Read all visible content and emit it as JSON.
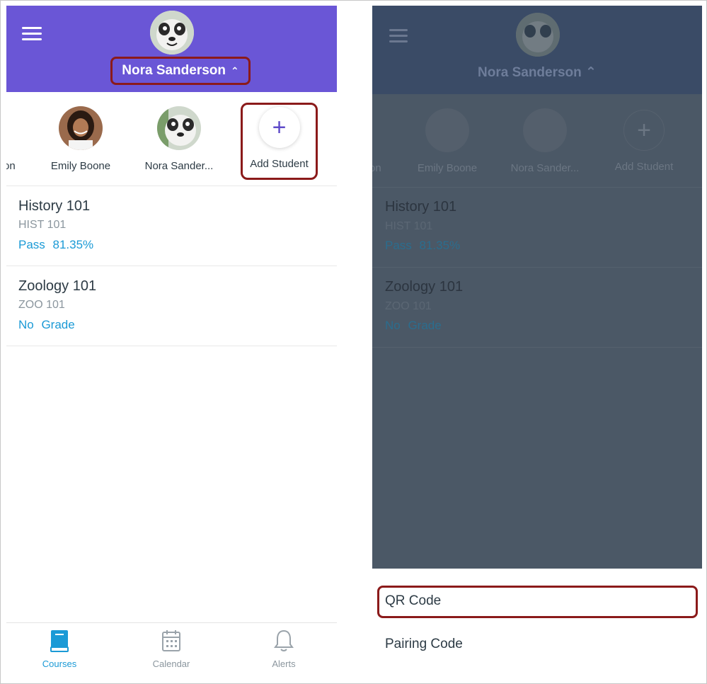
{
  "left": {
    "header": {
      "student_name": "Nora Sanderson",
      "chevron": "⌃"
    },
    "students": [
      {
        "label": "on"
      },
      {
        "label": "Emily Boone"
      },
      {
        "label": "Nora Sander..."
      },
      {
        "label": "Add Student"
      }
    ],
    "add_symbol": "+",
    "courses": [
      {
        "title": "History 101",
        "code": "HIST 101",
        "grade": "Pass 81.35%"
      },
      {
        "title": "Zoology 101",
        "code": "ZOO 101",
        "grade": "No Grade"
      }
    ],
    "tabs": [
      {
        "label": "Courses",
        "icon": "book-icon",
        "active": true
      },
      {
        "label": "Calendar",
        "icon": "calendar-icon",
        "active": false
      },
      {
        "label": "Alerts",
        "icon": "bell-icon",
        "active": false
      }
    ]
  },
  "right": {
    "header": {
      "student_name": "Nora Sanderson ⌃"
    },
    "students": [
      {
        "label": "on"
      },
      {
        "label": "Emily Boone"
      },
      {
        "label": "Nora Sander..."
      },
      {
        "label": "Add Student"
      }
    ],
    "add_symbol": "+",
    "courses": [
      {
        "title": "History 101",
        "code": "HIST 101",
        "grade": "Pass 81.35%"
      },
      {
        "title": "Zoology 101",
        "code": "ZOO 101",
        "grade": "No Grade"
      }
    ],
    "sheet": {
      "option_qr": "QR Code",
      "option_pairing": "Pairing Code"
    }
  },
  "colors": {
    "header_purple": "#6a56d6",
    "highlight_border": "#8b1a1a",
    "link_blue": "#1b9ad6",
    "text_dark": "#2d3b45",
    "text_muted": "#8b969e",
    "overlay": "#4b5866"
  }
}
